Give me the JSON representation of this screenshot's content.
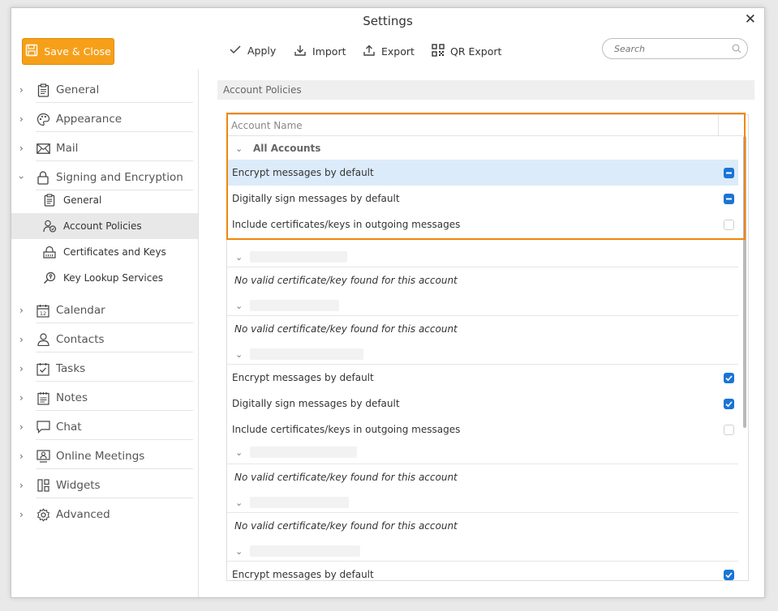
{
  "window": {
    "title": "Settings"
  },
  "toolbar": {
    "save_label": "Save & Close",
    "apply_label": "Apply",
    "import_label": "Import",
    "export_label": "Export",
    "qr_label": "QR Export",
    "search_placeholder": "Search"
  },
  "sidebar": {
    "items": [
      {
        "label": "General",
        "icon": "clipboard-icon"
      },
      {
        "label": "Appearance",
        "icon": "palette-icon"
      },
      {
        "label": "Mail",
        "icon": "envelope-icon"
      },
      {
        "label": "Signing and Encryption",
        "icon": "lock-icon"
      },
      {
        "label": "Calendar",
        "icon": "calendar-icon"
      },
      {
        "label": "Contacts",
        "icon": "person-icon"
      },
      {
        "label": "Tasks",
        "icon": "task-check-icon"
      },
      {
        "label": "Notes",
        "icon": "notes-icon"
      },
      {
        "label": "Chat",
        "icon": "chat-bubble-icon"
      },
      {
        "label": "Online Meetings",
        "icon": "meeting-icon"
      },
      {
        "label": "Widgets",
        "icon": "widgets-icon"
      },
      {
        "label": "Advanced",
        "icon": "gear-icon"
      }
    ],
    "sub_items": [
      {
        "label": "General",
        "icon": "clipboard-icon"
      },
      {
        "label": "Account Policies",
        "icon": "account-policy-icon"
      },
      {
        "label": "Certificates and Keys",
        "icon": "certificate-icon"
      },
      {
        "label": "Key Lookup Services",
        "icon": "key-search-icon"
      }
    ]
  },
  "main": {
    "section_title": "Account Policies",
    "column_header": "Account Name",
    "group_all": "All Accounts",
    "opt_encrypt": "Encrypt messages by default",
    "opt_sign": "Digitally sign messages by default",
    "opt_include": "Include certificates/keys in outgoing messages",
    "no_cert": "No valid certificate/key found for this account"
  },
  "states": {
    "all_encrypt": "indeterminate",
    "all_sign": "indeterminate",
    "all_include": "unchecked",
    "acct3_encrypt": "checked",
    "acct3_sign": "checked",
    "acct3_include": "unchecked",
    "acct6_encrypt": "checked"
  },
  "colors": {
    "accent": "#f6a01a",
    "highlight_border": "#f0860a",
    "checkbox_blue": "#1a74d6",
    "selected_row": "#dcebfa"
  }
}
